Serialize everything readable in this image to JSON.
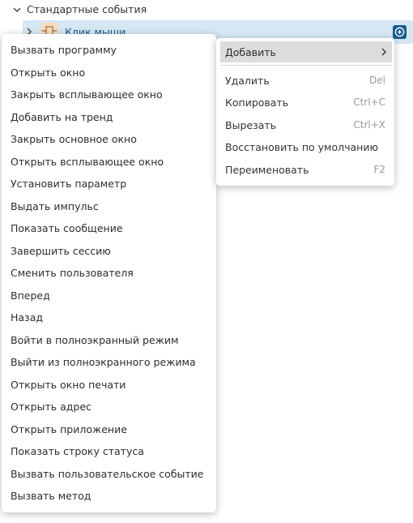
{
  "tree": {
    "header_title": "Стандартные события",
    "selected_item_label": "Клик мыши"
  },
  "submenu_items": [
    "Вызвать программу",
    "Открыть окно",
    "Закрыть всплывающее окно",
    "Добавить на тренд",
    "Закрыть основное окно",
    "Открыть всплывающее окно",
    "Установить параметр",
    "Выдать импульс",
    "Показать сообщение",
    "Завершить сессию",
    "Сменить пользователя",
    "Вперед",
    "Назад",
    "Войти в полноэкранный режим",
    "Выйти из полноэкранного режима",
    "Открыть окно печати",
    "Открыть адрес",
    "Открыть приложение",
    "Показать строку статуса",
    "Вызвать пользовательское событие",
    "Вызвать метод"
  ],
  "context_menu": {
    "add_label": "Добавить",
    "items": [
      {
        "label": "Удалить",
        "shortcut": "Del"
      },
      {
        "label": "Копировать",
        "shortcut": "Ctrl+C"
      },
      {
        "label": "Вырезать",
        "shortcut": "Ctrl+X"
      },
      {
        "label": "Восстановить по умолчанию",
        "shortcut": ""
      },
      {
        "label": "Переименовать",
        "shortcut": "F2"
      }
    ]
  },
  "colors": {
    "selection_bg": "#d5e7f3",
    "selected_text": "#1e5a8c",
    "accent_button": "#175a8e",
    "highlight_item": "#dcdcdc"
  }
}
